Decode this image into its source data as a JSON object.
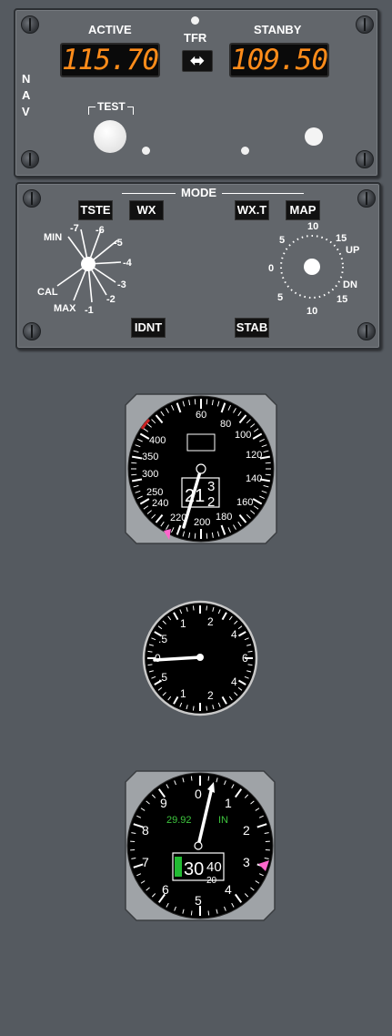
{
  "nav_panel": {
    "side_label": [
      "N",
      "A",
      "V"
    ],
    "active_label": "ACTIVE",
    "standby_label": "STANBY",
    "active_freq": "115.70",
    "standby_freq": "109.50",
    "transfer_label": "TFR",
    "transfer_arrow": "⬌",
    "test_label": "TEST"
  },
  "wx_panel": {
    "mode_label": "MODE",
    "buttons": {
      "tste": "TSTE",
      "wx": "WX",
      "wxt": "WX.T",
      "map": "MAP",
      "idnt": "IDNT",
      "stab": "STAB"
    },
    "gain_labels": [
      "MIN",
      "-7",
      "-6",
      "-5",
      "-4",
      "-3",
      "-2",
      "-1",
      "MAX",
      "CAL"
    ],
    "tilt_labels": [
      "10",
      "5",
      "15",
      "UP",
      "0",
      "5",
      "15",
      "DN",
      "10"
    ]
  },
  "airspeed": {
    "scale": [
      "60",
      "80",
      "100",
      "120",
      "140",
      "160",
      "180",
      "200",
      "220",
      "240",
      "250",
      "300",
      "350",
      "400"
    ],
    "readout_main": "21",
    "readout_upper": "3",
    "readout_lower": "2",
    "value": 213
  },
  "vsi": {
    "scale": [
      "1",
      "2",
      "4",
      "6",
      "4",
      "2",
      "1",
      "0",
      ".5",
      ".5"
    ]
  },
  "altimeter": {
    "scale": [
      "0",
      "1",
      "2",
      "3",
      "4",
      "5",
      "6",
      "7",
      "8",
      "9"
    ],
    "baro_value": "29.92",
    "baro_unit": "IN",
    "readout_main": "30",
    "readout_upper": "40",
    "readout_lower": "20"
  },
  "colors": {
    "display_digits": "#ff8c1a",
    "baro_text": "#3dc43d",
    "bug": "#ff66cc",
    "warning_arc": "#cc2222",
    "readout_flag": "#22bb33"
  }
}
